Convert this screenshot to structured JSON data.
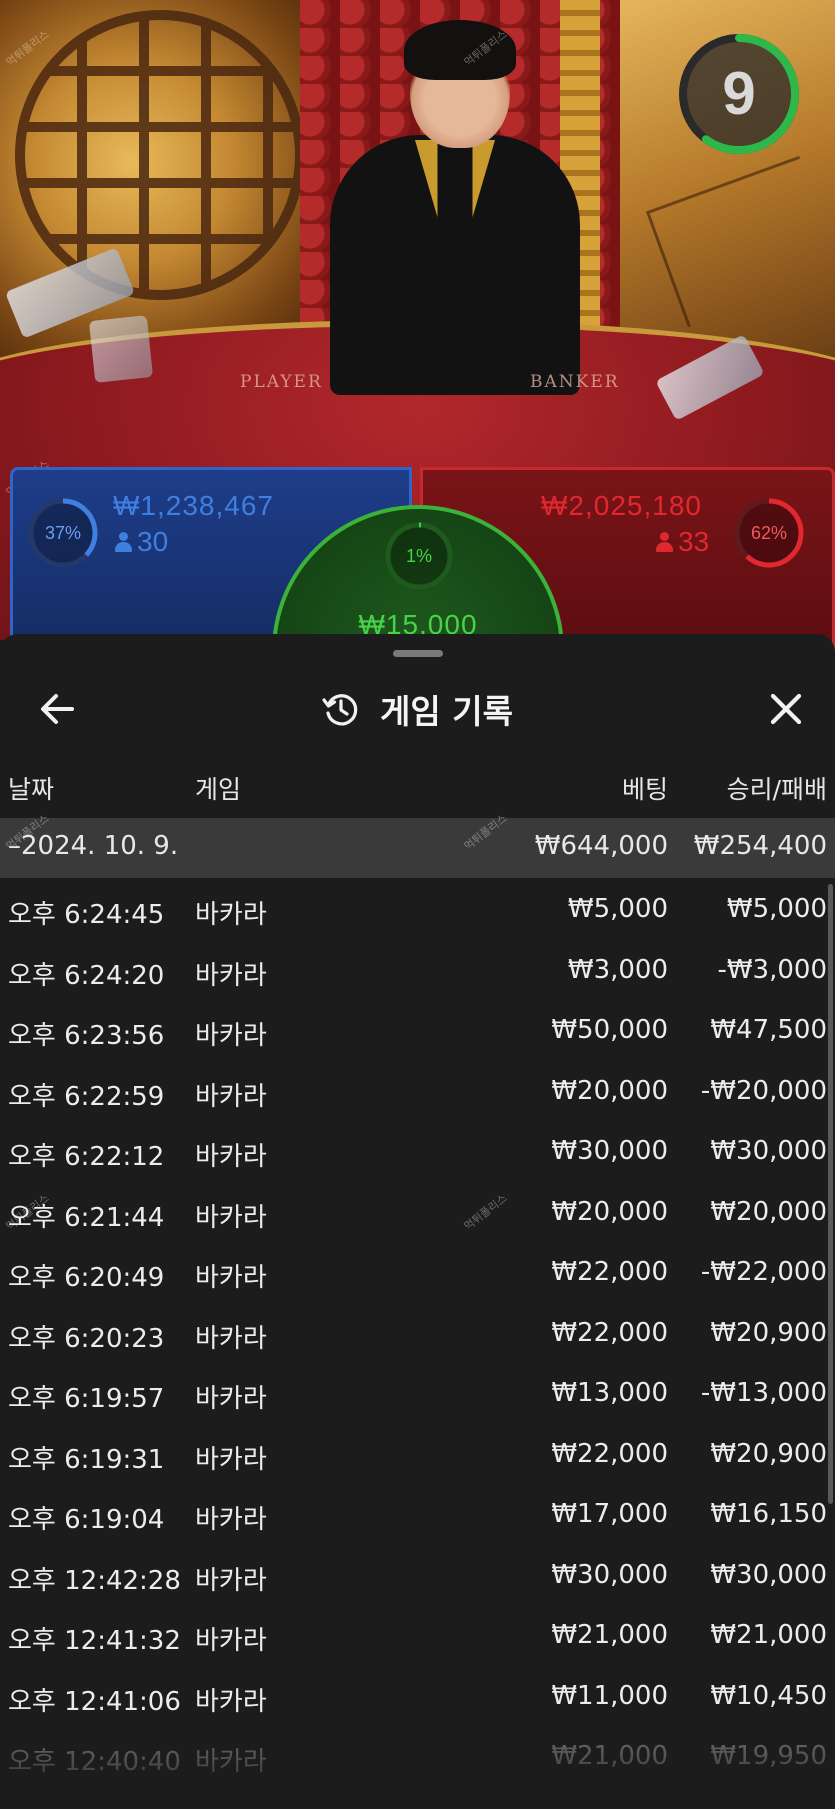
{
  "timer": {
    "value": "9",
    "progress": 0.6,
    "color": "#2fb84a"
  },
  "table_labels": {
    "player": "PLAYER",
    "banker": "BANKER"
  },
  "player": {
    "percent": "37%",
    "percent_value": 0.37,
    "amount": "₩1,238,467",
    "count": "30",
    "color": "#3f7fe0"
  },
  "banker": {
    "percent": "62%",
    "percent_value": 0.62,
    "amount": "₩2,025,180",
    "count": "33",
    "color": "#e0282e"
  },
  "tie": {
    "percent": "1%",
    "percent_value": 0.01,
    "amount": "₩15,000",
    "color": "#48d24a"
  },
  "watermark": "먹튀폴리스",
  "sheet": {
    "title": "게임 기록",
    "icons": {
      "back": "arrow-left-icon",
      "history": "history-icon",
      "close": "close-icon"
    },
    "columns": {
      "date": "날짜",
      "game": "게임",
      "bet": "베팅",
      "winloss": "승리/패배"
    },
    "summary": {
      "date": "–2024. 10. 9.",
      "bet": "₩644,000",
      "winloss": "₩254,400"
    },
    "rows": [
      {
        "time": "오후 6:24:45",
        "game": "바카라",
        "bet": "₩5,000",
        "winloss": "₩5,000"
      },
      {
        "time": "오후 6:24:20",
        "game": "바카라",
        "bet": "₩3,000",
        "winloss": "-₩3,000"
      },
      {
        "time": "오후 6:23:56",
        "game": "바카라",
        "bet": "₩50,000",
        "winloss": "₩47,500"
      },
      {
        "time": "오후 6:22:59",
        "game": "바카라",
        "bet": "₩20,000",
        "winloss": "-₩20,000"
      },
      {
        "time": "오후 6:22:12",
        "game": "바카라",
        "bet": "₩30,000",
        "winloss": "₩30,000"
      },
      {
        "time": "오후 6:21:44",
        "game": "바카라",
        "bet": "₩20,000",
        "winloss": "₩20,000"
      },
      {
        "time": "오후 6:20:49",
        "game": "바카라",
        "bet": "₩22,000",
        "winloss": "-₩22,000"
      },
      {
        "time": "오후 6:20:23",
        "game": "바카라",
        "bet": "₩22,000",
        "winloss": "₩20,900"
      },
      {
        "time": "오후 6:19:57",
        "game": "바카라",
        "bet": "₩13,000",
        "winloss": "-₩13,000"
      },
      {
        "time": "오후 6:19:31",
        "game": "바카라",
        "bet": "₩22,000",
        "winloss": "₩20,900"
      },
      {
        "time": "오후 6:19:04",
        "game": "바카라",
        "bet": "₩17,000",
        "winloss": "₩16,150"
      },
      {
        "time": "오후 12:42:28",
        "game": "바카라",
        "bet": "₩30,000",
        "winloss": "₩30,000"
      },
      {
        "time": "오후 12:41:32",
        "game": "바카라",
        "bet": "₩21,000",
        "winloss": "₩21,000"
      },
      {
        "time": "오후 12:41:06",
        "game": "바카라",
        "bet": "₩11,000",
        "winloss": "₩10,450"
      },
      {
        "time": "오후 12:40:40",
        "game": "바카라",
        "bet": "₩21,000",
        "winloss": "₩19,950"
      }
    ]
  }
}
